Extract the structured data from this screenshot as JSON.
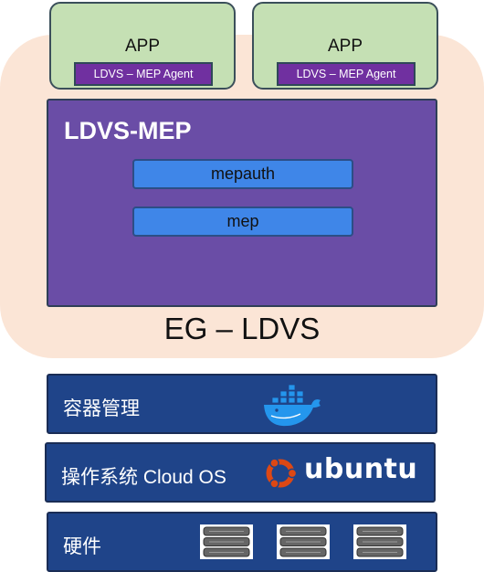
{
  "apps": [
    {
      "title": "APP",
      "agent": "LDVS – MEP Agent"
    },
    {
      "title": "APP",
      "agent": "LDVS – MEP Agent"
    }
  ],
  "mep": {
    "title": "LDVS-MEP",
    "services": [
      "mepauth",
      "mep"
    ]
  },
  "eg_label": "EG – LDVS",
  "layers": {
    "container": {
      "label": "容器管理",
      "icon": "docker-whale-icon"
    },
    "os": {
      "label": "操作系统 Cloud OS",
      "logo_text": "ubuntu",
      "icon": "ubuntu-logo-icon"
    },
    "hardware": {
      "label": "硬件",
      "icon": "server-rack-icon"
    }
  },
  "colors": {
    "eg_background": "#fbe5d6",
    "app_box": "#c5e0b4",
    "agent_box": "#7030a0",
    "mep_box": "#6a4da6",
    "service_box": "#3f86e8",
    "layer_box": "#1f4489",
    "docker_blue": "#2496ed",
    "ubuntu_orange": "#dd4814"
  }
}
